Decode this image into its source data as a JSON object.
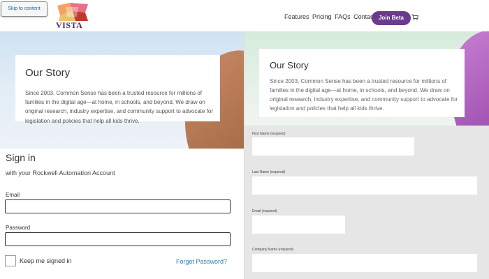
{
  "header": {
    "skip_link": "Skip to content",
    "logo_text": "VISTA",
    "nav": [
      "Features",
      "Pricing",
      "FAQs",
      "Contact"
    ],
    "join_button": "Join Beta"
  },
  "story_left": {
    "title": "Our Story",
    "body": "Since 2003, Common Sense has been a trusted resource for millions of families in the digital age—at home, in schools, and beyond. We draw on original research, industry expertise, and community support to advocate for legislation and policies that help all kids thrive."
  },
  "signin": {
    "title": "Sign in",
    "subtitle": "with your Rockwell Automation Account",
    "email_label": "Email",
    "password_label": "Password",
    "keep_signed_in": "Keep me signed in",
    "forgot_password": "Forgot Password?"
  },
  "story_right": {
    "title": "Our Story",
    "body": "Since 2003, Common Sense has been a trusted resource for millions of families in the digital age—at home, in schools, and beyond. We draw on original research, industry expertise, and community support to advocate for legislation and policies that help all kids thrive."
  },
  "form_right": {
    "first_name_label": "First Name (required)",
    "last_name_label": "Last Name (required)",
    "email_label": "Email (required)",
    "company_label": "Company Name (required)"
  },
  "colors": {
    "brand_purple": "#6b3a8e",
    "link_blue": "#2e7fb0"
  }
}
